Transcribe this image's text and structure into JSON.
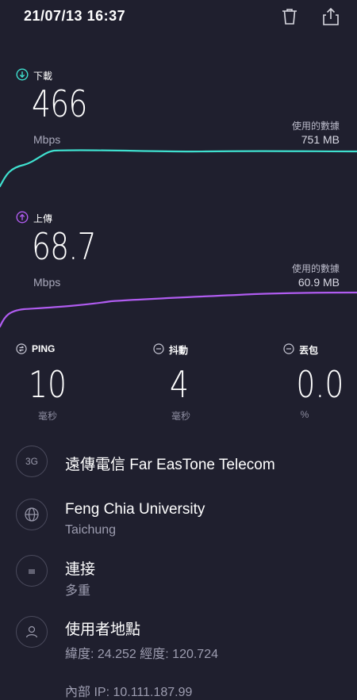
{
  "header": {
    "datetime": "21/07/13 16:37",
    "delete_icon": "trash-icon",
    "share_icon": "share-icon"
  },
  "download": {
    "label": "下載",
    "value": "466",
    "unit": "Mbps",
    "used_label": "使用的數據",
    "used_value": "751 MB",
    "color": "#3fe0cf"
  },
  "upload": {
    "label": "上傳",
    "value": "68.7",
    "unit": "Mbps",
    "used_label": "使用的數據",
    "used_value": "60.9 MB",
    "color": "#b05cf0"
  },
  "metrics": {
    "ping": {
      "label": "PING",
      "value": "10",
      "unit": "毫秒"
    },
    "jitter": {
      "label": "抖動",
      "value": "4",
      "unit": "毫秒"
    },
    "loss": {
      "label": "丟包",
      "value": "0.0",
      "unit": "%"
    }
  },
  "info": {
    "provider": {
      "icon_text": "3G",
      "name": "遠傳電信 Far EasTone Telecom"
    },
    "server": {
      "name": "Feng Chia University",
      "city": "Taichung"
    },
    "connection": {
      "title": "連接",
      "value": "多重"
    },
    "location": {
      "title": "使用者地點",
      "coords": "緯度: 24.252 經度: 120.724"
    },
    "internal_ip": "內部 IP: 10.111.187.99"
  }
}
